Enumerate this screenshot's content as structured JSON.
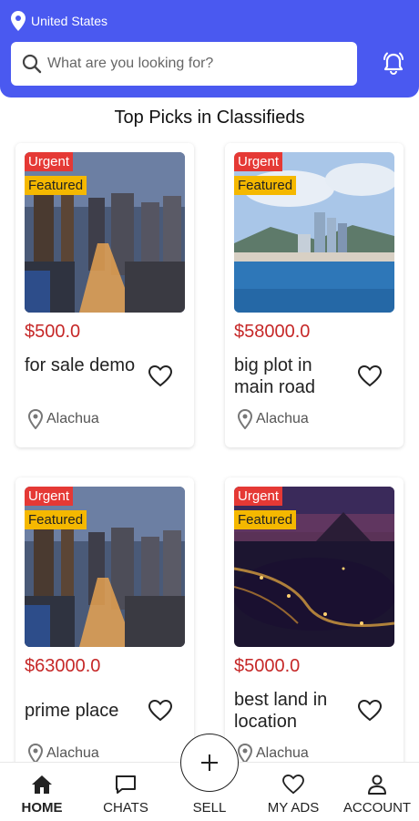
{
  "header": {
    "location": "United States",
    "search_placeholder": "What are you looking for?"
  },
  "section_title": "Top Picks in Classifieds",
  "listings": [
    {
      "urgent": "Urgent",
      "featured": "Featured",
      "price": "$500.0",
      "title": "for sale demo",
      "location": "Alachua",
      "image": "city-night"
    },
    {
      "urgent": "Urgent",
      "featured": "Featured",
      "price": "$58000.0",
      "title": "big plot in main road",
      "location": "Alachua",
      "image": "harbor-day"
    },
    {
      "urgent": "Urgent",
      "featured": "Featured",
      "price": "$63000.0",
      "title": "prime place",
      "location": "Alachua",
      "image": "city-night"
    },
    {
      "urgent": "Urgent",
      "featured": "Featured",
      "price": "$5000.0",
      "title": "best land in location",
      "location": "Alachua",
      "image": "coast-night"
    }
  ],
  "nav": {
    "home": "HOME",
    "chats": "CHATS",
    "sell": "SELL",
    "my_ads": "MY ADS",
    "account": "ACCOUNT"
  },
  "colors": {
    "header": "#4a59f0",
    "price": "#c62828",
    "urgent": "#e53935",
    "featured": "#f5b800"
  }
}
